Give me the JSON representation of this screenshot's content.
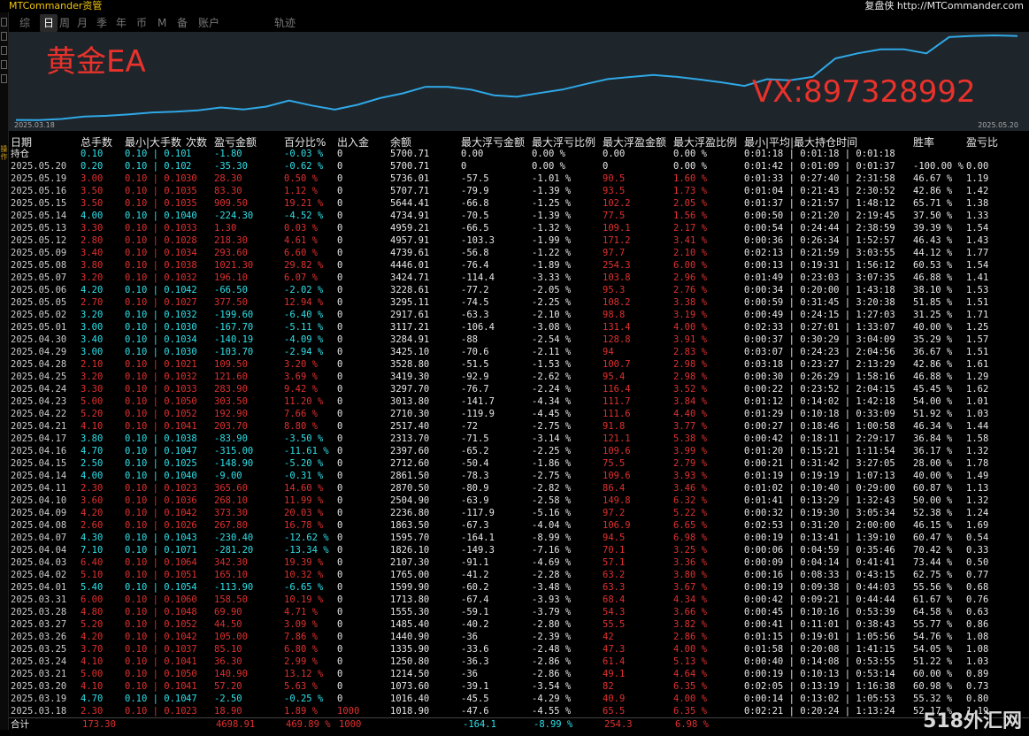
{
  "titlebar": {
    "left": "MTCommander资管",
    "right": "复盘侠 http://MTCommander.com"
  },
  "left_label": "操作",
  "tabs": [
    "综",
    "日",
    "周",
    "月",
    "季",
    "年",
    "币",
    "M",
    "备",
    "账户",
    "轨迹"
  ],
  "active_tab": 1,
  "chart": {
    "label_ea": "黄金EA",
    "label_vx": "VX:897328992",
    "date_start": "2025.03.18",
    "date_end": "2025.05.20",
    "line_color": "#2fa8e6"
  },
  "columns": [
    "日期",
    "总手数",
    "最小|大手数",
    "次数",
    "盈亏金额",
    "百分比%",
    "出入金",
    "余额",
    "最大浮亏金额",
    "最大浮亏比例",
    "最大浮盈金额",
    "最大浮盈比例",
    "最小|平均|最大持仓时间",
    "胜率",
    "盈亏比"
  ],
  "holding_label": "持仓",
  "rows": [
    [
      "持仓",
      "0.10",
      "0.10 | 0.10",
      "1",
      "-1.80",
      "-0.03 %",
      "0",
      "5700.71",
      "0.00",
      "0.00 %",
      "0.00",
      "0.00 %",
      "0:01:18 | 0:01:18 | 0:01:18",
      "",
      ""
    ],
    [
      "2025.05.20",
      "0.20",
      "0.10 | 0.10",
      "2",
      "-35.30",
      "-0.62 %",
      "0",
      "5700.71",
      "0",
      "0.00 %",
      "0",
      "0.00 %",
      "0:01:42 | 0:01:09 | 0:01:37",
      "-100.00 %",
      "0.00"
    ],
    [
      "2025.05.19",
      "3.00",
      "0.10 | 0.10",
      "30",
      "28.30",
      "0.50 %",
      "0",
      "5736.01",
      "-57.5",
      "-1.01 %",
      "90.5",
      "1.60 %",
      "0:01:33 | 0:27:40 | 2:31:58",
      "46.67 %",
      "1.19"
    ],
    [
      "2025.05.16",
      "3.50",
      "0.10 | 0.10",
      "35",
      "83.30",
      "1.12 %",
      "0",
      "5707.71",
      "-79.9",
      "-1.39 %",
      "93.5",
      "1.73 %",
      "0:01:04 | 0:21:43 | 2:30:52",
      "42.86 %",
      "1.42"
    ],
    [
      "2025.05.15",
      "3.50",
      "0.10 | 0.10",
      "35",
      "909.50",
      "19.21 %",
      "0",
      "5644.41",
      "-66.8",
      "-1.25 %",
      "102.2",
      "2.05 %",
      "0:01:37 | 0:21:57 | 1:48:12",
      "65.71 %",
      "1.38"
    ],
    [
      "2025.05.14",
      "4.00",
      "0.10 | 0.10",
      "40",
      "-224.30",
      "-4.52 %",
      "0",
      "4734.91",
      "-70.5",
      "-1.39 %",
      "77.5",
      "1.56 %",
      "0:00:50 | 0:21:20 | 2:19:45",
      "37.50 %",
      "1.33"
    ],
    [
      "2025.05.13",
      "3.30",
      "0.10 | 0.10",
      "33",
      "1.30",
      "0.03 %",
      "0",
      "4959.21",
      "-66.5",
      "-1.32 %",
      "109.1",
      "2.17 %",
      "0:00:54 | 0:24:44 | 2:38:59",
      "39.39 %",
      "1.54"
    ],
    [
      "2025.05.12",
      "2.80",
      "0.10 | 0.10",
      "28",
      "218.30",
      "4.61 %",
      "0",
      "4957.91",
      "-103.3",
      "-1.99 %",
      "171.2",
      "3.41 %",
      "0:00:36 | 0:26:34 | 1:52:57",
      "46.43 %",
      "1.43"
    ],
    [
      "2025.05.09",
      "3.40",
      "0.10 | 0.10",
      "34",
      "293.60",
      "6.60 %",
      "0",
      "4739.61",
      "-56.8",
      "-1.22 %",
      "97.7",
      "2.10 %",
      "0:02:13 | 0:21:59 | 3:03:55",
      "44.12 %",
      "1.77"
    ],
    [
      "2025.05.08",
      "3.80",
      "0.10 | 0.10",
      "38",
      "1021.30",
      "29.82 %",
      "0",
      "4446.01",
      "-76.4",
      "-1.89 %",
      "254.3",
      "6.00 %",
      "0:00:13 | 0:19:31 | 1:56:12",
      "60.53 %",
      "1.54"
    ],
    [
      "2025.05.07",
      "3.20",
      "0.10 | 0.10",
      "32",
      "196.10",
      "6.07 %",
      "0",
      "3424.71",
      "-114.4",
      "-3.33 %",
      "103.8",
      "2.96 %",
      "0:01:49 | 0:23:03 | 3:07:35",
      "46.88 %",
      "1.41"
    ],
    [
      "2025.05.06",
      "4.20",
      "0.10 | 0.10",
      "42",
      "-66.50",
      "-2.02 %",
      "0",
      "3228.61",
      "-77.2",
      "-2.05 %",
      "95.3",
      "2.76 %",
      "0:00:34 | 0:20:00 | 1:43:18",
      "38.10 %",
      "1.53"
    ],
    [
      "2025.05.05",
      "2.70",
      "0.10 | 0.10",
      "27",
      "377.50",
      "12.94 %",
      "0",
      "3295.11",
      "-74.5",
      "-2.25 %",
      "108.2",
      "3.38 %",
      "0:00:59 | 0:31:45 | 3:20:38",
      "51.85 %",
      "1.51"
    ],
    [
      "2025.05.02",
      "3.20",
      "0.10 | 0.10",
      "32",
      "-199.60",
      "-6.40 %",
      "0",
      "2917.61",
      "-63.3",
      "-2.10 %",
      "98.8",
      "3.19 %",
      "0:00:49 | 0:24:15 | 1:27:03",
      "31.25 %",
      "1.71"
    ],
    [
      "2025.05.01",
      "3.00",
      "0.10 | 0.10",
      "30",
      "-167.70",
      "-5.11 %",
      "0",
      "3117.21",
      "-106.4",
      "-3.08 %",
      "131.4",
      "4.00 %",
      "0:02:33 | 0:27:01 | 1:33:07",
      "40.00 %",
      "1.25"
    ],
    [
      "2025.04.30",
      "3.40",
      "0.10 | 0.10",
      "34",
      "-140.19",
      "-4.09 %",
      "0",
      "3284.91",
      "-88",
      "-2.54 %",
      "128.8",
      "3.91 %",
      "0:00:37 | 0:30:29 | 3:04:09",
      "35.29 %",
      "1.57"
    ],
    [
      "2025.04.29",
      "3.00",
      "0.10 | 0.10",
      "30",
      "-103.70",
      "-2.94 %",
      "0",
      "3425.10",
      "-70.6",
      "-2.11 %",
      "94",
      "2.83 %",
      "0:03:07 | 0:24:23 | 2:04:56",
      "36.67 %",
      "1.51"
    ],
    [
      "2025.04.28",
      "2.10",
      "0.10 | 0.10",
      "21",
      "109.50",
      "3.20 %",
      "0",
      "3528.80",
      "-51.5",
      "-1.53 %",
      "100.7",
      "2.98 %",
      "0:03:18 | 0:23:27 | 2:13:29",
      "42.86 %",
      "1.61"
    ],
    [
      "2025.04.25",
      "3.20",
      "0.10 | 0.10",
      "32",
      "121.60",
      "3.69 %",
      "0",
      "3419.30",
      "-92.9",
      "-2.62 %",
      "95.4",
      "2.98 %",
      "0:00:30 | 0:26:29 | 1:58:16",
      "46.88 %",
      "1.29"
    ],
    [
      "2025.04.24",
      "3.30",
      "0.10 | 0.10",
      "33",
      "283.90",
      "9.42 %",
      "0",
      "3297.70",
      "-76.7",
      "-2.24 %",
      "116.4",
      "3.52 %",
      "0:00:22 | 0:23:52 | 2:04:15",
      "45.45 %",
      "1.62"
    ],
    [
      "2025.04.23",
      "5.00",
      "0.10 | 0.10",
      "50",
      "303.50",
      "11.20 %",
      "0",
      "3013.80",
      "-141.7",
      "-4.34 %",
      "111.7",
      "3.84 %",
      "0:01:12 | 0:14:02 | 1:42:18",
      "54.00 %",
      "1.01"
    ],
    [
      "2025.04.22",
      "5.20",
      "0.10 | 0.10",
      "52",
      "192.90",
      "7.66 %",
      "0",
      "2710.30",
      "-119.9",
      "-4.45 %",
      "111.6",
      "4.40 %",
      "0:01:29 | 0:10:18 | 0:33:09",
      "51.92 %",
      "1.03"
    ],
    [
      "2025.04.21",
      "4.10",
      "0.10 | 0.10",
      "41",
      "203.70",
      "8.80 %",
      "0",
      "2517.40",
      "-72",
      "-2.75 %",
      "91.8",
      "3.77 %",
      "0:00:27 | 0:18:46 | 1:00:58",
      "46.34 %",
      "1.44"
    ],
    [
      "2025.04.17",
      "3.80",
      "0.10 | 0.10",
      "38",
      "-83.90",
      "-3.50 %",
      "0",
      "2313.70",
      "-71.5",
      "-3.14 %",
      "121.1",
      "5.38 %",
      "0:00:42 | 0:18:11 | 2:29:17",
      "36.84 %",
      "1.58"
    ],
    [
      "2025.04.16",
      "4.70",
      "0.10 | 0.10",
      "47",
      "-315.00",
      "-11.61 %",
      "0",
      "2397.60",
      "-65.2",
      "-2.25 %",
      "109.6",
      "3.99 %",
      "0:01:20 | 0:15:21 | 1:11:54",
      "36.17 %",
      "1.32"
    ],
    [
      "2025.04.15",
      "2.50",
      "0.10 | 0.10",
      "25",
      "-148.90",
      "-5.20 %",
      "0",
      "2712.60",
      "-50.4",
      "-1.86 %",
      "75.5",
      "2.79 %",
      "0:00:21 | 0:31:42 | 3:27:05",
      "28.00 %",
      "1.78"
    ],
    [
      "2025.04.14",
      "4.00",
      "0.10 | 0.10",
      "40",
      "-9.00",
      "-0.31 %",
      "0",
      "2861.50",
      "-78.3",
      "-2.75 %",
      "109.6",
      "3.93 %",
      "0:01:19 | 0:19:19 | 1:07:13",
      "40.00 %",
      "1.49"
    ],
    [
      "2025.04.11",
      "2.30",
      "0.10 | 0.10",
      "23",
      "365.60",
      "14.60 %",
      "0",
      "2870.50",
      "-80.9",
      "-2.82 %",
      "86.4",
      "3.46 %",
      "0:01:02 | 0:10:40 | 0:29:00",
      "60.87 %",
      "1.13"
    ],
    [
      "2025.04.10",
      "3.60",
      "0.10 | 0.10",
      "36",
      "268.10",
      "11.99 %",
      "0",
      "2504.90",
      "-63.9",
      "-2.58 %",
      "149.8",
      "6.32 %",
      "0:01:41 | 0:13:29 | 1:32:43",
      "50.00 %",
      "1.32"
    ],
    [
      "2025.04.09",
      "4.20",
      "0.10 | 0.10",
      "42",
      "373.30",
      "20.03 %",
      "0",
      "2236.80",
      "-117.9",
      "-5.16 %",
      "97.2",
      "5.22 %",
      "0:00:32 | 0:19:30 | 3:05:34",
      "52.38 %",
      "1.24"
    ],
    [
      "2025.04.08",
      "2.60",
      "0.10 | 0.10",
      "26",
      "267.80",
      "16.78 %",
      "0",
      "1863.50",
      "-67.3",
      "-4.04 %",
      "106.9",
      "6.65 %",
      "0:02:53 | 0:31:20 | 2:00:00",
      "46.15 %",
      "1.69"
    ],
    [
      "2025.04.07",
      "4.30",
      "0.10 | 0.10",
      "43",
      "-230.40",
      "-12.62 %",
      "0",
      "1595.70",
      "-164.1",
      "-8.99 %",
      "94.5",
      "6.98 %",
      "0:00:19 | 0:13:41 | 1:39:10",
      "60.47 %",
      "0.54"
    ],
    [
      "2025.04.04",
      "7.10",
      "0.10 | 0.10",
      "71",
      "-281.20",
      "-13.34 %",
      "0",
      "1826.10",
      "-149.3",
      "-7.16 %",
      "70.1",
      "3.25 %",
      "0:00:06 | 0:04:59 | 0:35:46",
      "70.42 %",
      "0.33"
    ],
    [
      "2025.04.03",
      "6.40",
      "0.10 | 0.10",
      "64",
      "342.30",
      "19.39 %",
      "0",
      "2107.30",
      "-91.1",
      "-4.69 %",
      "57.1",
      "3.36 %",
      "0:00:09 | 0:04:14 | 0:41:41",
      "73.44 %",
      "0.50"
    ],
    [
      "2025.04.02",
      "5.10",
      "0.10 | 0.10",
      "51",
      "165.10",
      "10.32 %",
      "0",
      "1765.00",
      "-41.2",
      "-2.28 %",
      "63.2",
      "3.80 %",
      "0:00:16 | 0:08:33 | 0:43:15",
      "62.75 %",
      "0.77"
    ],
    [
      "2025.04.01",
      "5.40",
      "0.10 | 0.10",
      "54",
      "-113.90",
      "-6.65 %",
      "0",
      "1599.90",
      "-60.2",
      "-3.48 %",
      "63.3",
      "3.67 %",
      "0:00:19 | 0:09:38 | 0:44:03",
      "55.56 %",
      "0.68"
    ],
    [
      "2025.03.31",
      "6.00",
      "0.10 | 0.10",
      "60",
      "158.50",
      "10.19 %",
      "0",
      "1713.80",
      "-67.4",
      "-3.93 %",
      "68.4",
      "4.34 %",
      "0:00:42 | 0:09:21 | 0:44:44",
      "61.67 %",
      "0.76"
    ],
    [
      "2025.03.28",
      "4.80",
      "0.10 | 0.10",
      "48",
      "69.90",
      "4.71 %",
      "0",
      "1555.30",
      "-59.1",
      "-3.79 %",
      "54.3",
      "3.66 %",
      "0:00:45 | 0:10:16 | 0:53:39",
      "64.58 %",
      "0.63"
    ],
    [
      "2025.03.27",
      "5.20",
      "0.10 | 0.10",
      "52",
      "44.50",
      "3.09 %",
      "0",
      "1485.40",
      "-40.2",
      "-2.80 %",
      "55.5",
      "3.82 %",
      "0:00:41 | 0:11:01 | 0:38:43",
      "55.77 %",
      "0.86"
    ],
    [
      "2025.03.26",
      "4.20",
      "0.10 | 0.10",
      "42",
      "105.00",
      "7.86 %",
      "0",
      "1440.90",
      "-36",
      "-2.39 %",
      "42",
      "2.86 %",
      "0:01:15 | 0:19:01 | 1:05:56",
      "54.76 %",
      "1.08"
    ],
    [
      "2025.03.25",
      "3.70",
      "0.10 | 0.10",
      "37",
      "85.10",
      "6.80 %",
      "0",
      "1335.90",
      "-33.6",
      "-2.48 %",
      "47.3",
      "4.00 %",
      "0:01:58 | 0:20:08 | 1:41:15",
      "54.05 %",
      "1.08"
    ],
    [
      "2025.03.24",
      "4.10",
      "0.10 | 0.10",
      "41",
      "36.30",
      "2.99 %",
      "0",
      "1250.80",
      "-36.3",
      "-2.86 %",
      "61.4",
      "5.13 %",
      "0:00:40 | 0:14:08 | 0:53:55",
      "51.22 %",
      "1.03"
    ],
    [
      "2025.03.21",
      "5.00",
      "0.10 | 0.10",
      "50",
      "140.90",
      "13.12 %",
      "0",
      "1214.50",
      "-36",
      "-2.86 %",
      "49.1",
      "4.64 %",
      "0:00:19 | 0:10:13 | 0:53:14",
      "60.00 %",
      "0.89"
    ],
    [
      "2025.03.20",
      "4.10",
      "0.10 | 0.10",
      "41",
      "57.20",
      "5.63 %",
      "0",
      "1073.60",
      "-39.1",
      "-3.54 %",
      "82",
      "6.35 %",
      "0:02:05 | 0:13:19 | 1:16:38",
      "60.98 %",
      "0.73"
    ],
    [
      "2025.03.19",
      "4.70",
      "0.10 | 0.10",
      "47",
      "-2.50",
      "-0.25 %",
      "0",
      "1016.40",
      "-45.5",
      "-4.29 %",
      "40.9",
      "4.00 %",
      "0:00:14 | 0:13:02 | 1:05:53",
      "55.32 %",
      "0.80"
    ],
    [
      "2025.03.18",
      "2.30",
      "0.10 | 0.10",
      "23",
      "18.90",
      "1.89 %",
      "1000",
      "1018.90",
      "-47.6",
      "-4.55 %",
      "65.5",
      "6.35 %",
      "0:02:21 | 0:20:24 | 1:13:24",
      "52.17 %",
      "1.19"
    ]
  ],
  "total": {
    "label": "合计",
    "lots": "173.30",
    "pnl": "4698.91",
    "pct": "469.89 %",
    "deposit": "1000",
    "max_float_loss": "-164.1",
    "max_float_loss_pct": "-8.99 %",
    "max_float_gain": "254.3",
    "max_float_gain_pct": "6.98 %"
  },
  "watermark": "518外汇网",
  "colors": {
    "profit": "#e03030",
    "loss": "#2ee0e8",
    "accent": "#f1c40f"
  }
}
